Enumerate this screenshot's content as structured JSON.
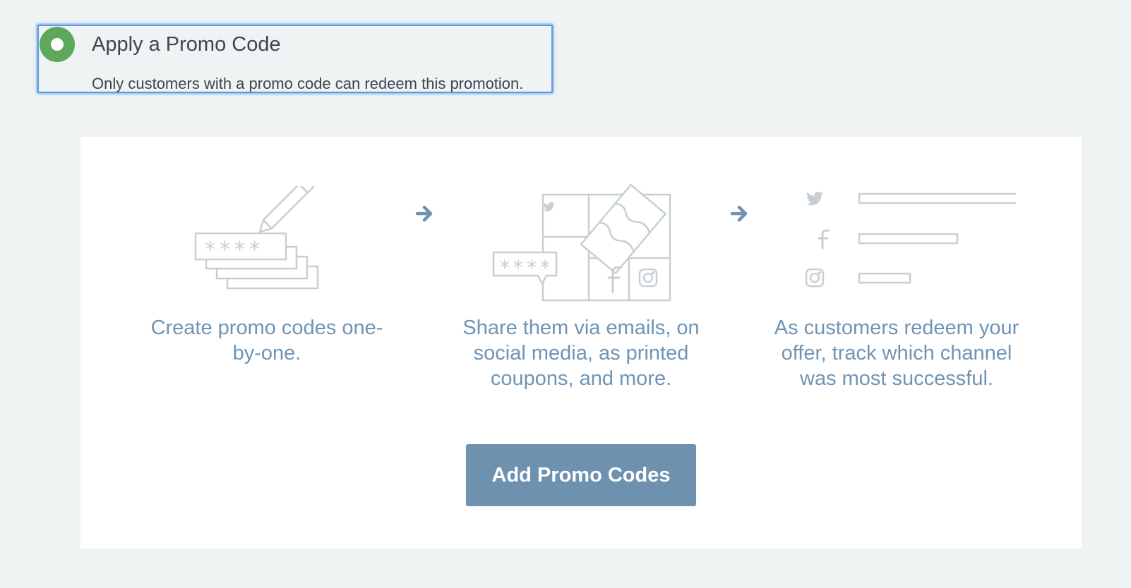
{
  "option": {
    "title": "Apply a Promo Code",
    "description": "Only customers with a promo code can redeem this promotion.",
    "selected": true,
    "radio_color": "#5ea85a"
  },
  "panel": {
    "illustrations": [
      {
        "icon": "code-pencil-illustration",
        "masked_code": "****"
      },
      {
        "icon": "share-channels-illustration",
        "masked_code": "****"
      },
      {
        "icon": "channel-tracking-illustration"
      }
    ],
    "steps": [
      {
        "text": "Create promo codes one-by-one."
      },
      {
        "text": "Share them via emails, on social media, as printed coupons, and more."
      },
      {
        "text": "As customers redeem your offer, track which channel was most successful."
      }
    ],
    "button_label": "Add Promo Codes"
  },
  "colors": {
    "accent": "#6e91b0",
    "text_accent": "#6f94b5",
    "illustration_stroke": "#c7cfd4",
    "background": "#eff3f4"
  }
}
